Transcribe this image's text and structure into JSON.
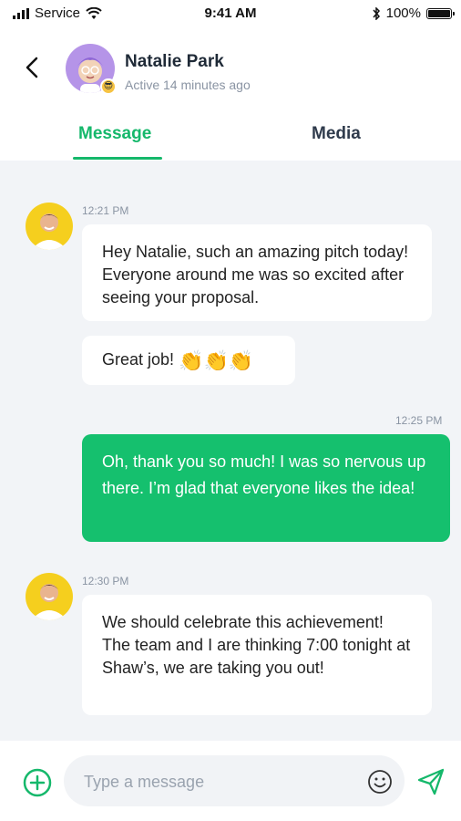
{
  "status_bar": {
    "carrier": "Service",
    "time": "9:41 AM",
    "battery": "100%"
  },
  "header": {
    "contact_name": "Natalie Park",
    "activity": "Active 14 minutes ago",
    "tabs": [
      {
        "label": "Message",
        "active": true
      },
      {
        "label": "Media",
        "active": false
      }
    ]
  },
  "colors": {
    "accent": "#15b86b",
    "outgoing_bubble": "#15c06e",
    "avatar_contact_bg": "#b594e8",
    "avatar_sender_bg": "#f5cf1e"
  },
  "messages": [
    {
      "direction": "in",
      "time": "12:21 PM",
      "text": "Hey Natalie, such an amazing pitch today! Everyone around me was so excited after seeing your proposal."
    },
    {
      "direction": "in",
      "time": "",
      "text": "Great job!",
      "emoji": "👏👏👏"
    },
    {
      "direction": "out",
      "time": "12:25 PM",
      "text": "Oh, thank you so much! I was so nervous up there. I’m glad that everyone likes the idea!"
    },
    {
      "direction": "in",
      "time": "12:30 PM",
      "text": "We should celebrate this achievement! The team and I are thinking 7:00 tonight at Shaw’s, we are taking you out!"
    }
  ],
  "composer": {
    "placeholder": "Type a message",
    "value": "",
    "icons": [
      "plus-circle-icon",
      "smiley-icon",
      "send-icon"
    ]
  }
}
